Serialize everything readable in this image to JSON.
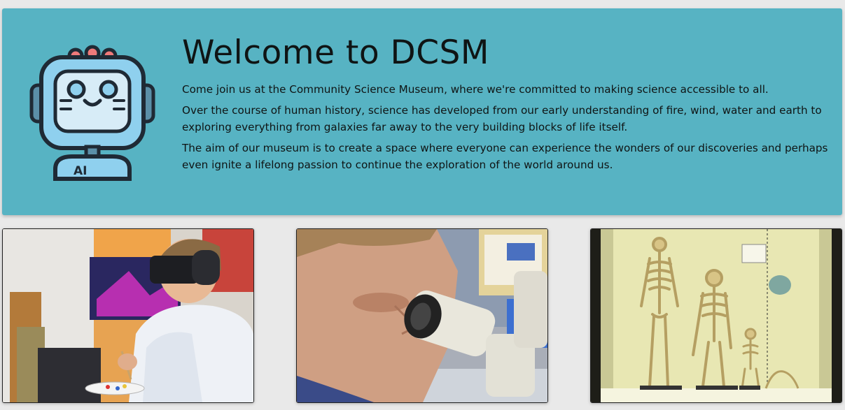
{
  "hero": {
    "logo_icon": "robot-ai-icon",
    "logo_label": "AI",
    "title": "Welcome to DCSM",
    "paragraphs": [
      "Come join us at the Community Science Museum, where we're committed to making science accessible to all.",
      "Over the course of human history, science has developed from our early understanding of fire, wind, water and earth to exploring everything from galaxies far away to the very building blocks of life itself.",
      "The aim of our museum is to create a space where everyone can experience the wonders of our discoveries and perhaps even ignite a lifelong passion to continue the exploration of the world around us."
    ]
  },
  "gallery": [
    {
      "icon": "vr-headset-painting-photo"
    },
    {
      "icon": "microscope-photo"
    },
    {
      "icon": "skeleton-display-photo"
    }
  ],
  "colors": {
    "page_bg": "#e9e9e9",
    "hero_bg": "#57b3c3",
    "text": "#0f1414",
    "robot_screen": "#d7ecf7",
    "robot_body": "#8fd0ee",
    "robot_accent": "#f07a7a"
  }
}
